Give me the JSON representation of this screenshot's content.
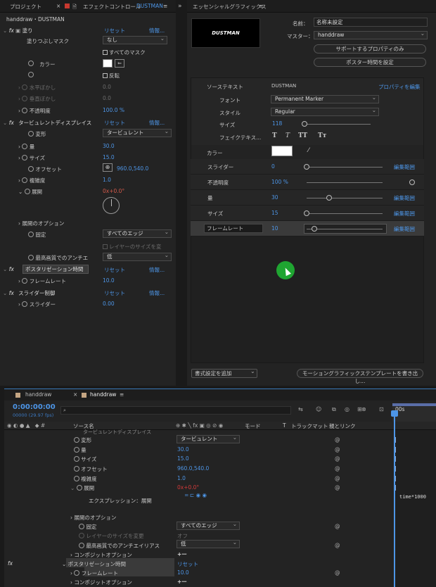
{
  "effect_controls": {
    "tab_project": "プロジェクト",
    "tab_effect_controls": "エフェクトコントロール",
    "tab_effect_target": "DUSTMAN",
    "breadcrumb": "handdraw・DUSTMAN",
    "reset": "リセット",
    "info": "情報...",
    "fill": {
      "name": "塗り",
      "mask_label": "塗りつぶしマスク",
      "mask_value": "なし",
      "all_masks": "すべてのマスク",
      "color_label": "カラー",
      "invert": "反転",
      "h_feather": "水平ぼかし",
      "h_feather_value": "0.0",
      "v_feather": "垂直ぼかし",
      "v_feather_value": "0.0",
      "opacity_label": "不透明度",
      "opacity_value": "100.0 %"
    },
    "turbulent": {
      "name": "タービュレントディスプレイス",
      "displace_label": "変形",
      "displace_value": "タービュレント",
      "amount_label": "量",
      "amount_value": "30.0",
      "size_label": "サイズ",
      "size_value": "15.0",
      "offset_label": "オフセット",
      "offset_value": "960.0,540.0",
      "complexity_label": "複雑度",
      "complexity_value": "1.0",
      "evolution_label": "展開",
      "evolution_value": "0x+0.0°",
      "evo_options": "展開のオプション",
      "pinning_label": "固定",
      "pinning_value": "すべてのエッジ",
      "resize_layer": "レイヤーのサイズを変",
      "aa_label": "最高画質でのアンチエ",
      "aa_value": "低"
    },
    "posterize": {
      "name": "ポスタリゼーション時間",
      "framerate_label": "フレームレート",
      "framerate_value": "10.0"
    },
    "slider": {
      "name": "スライダー制御",
      "slider_label": "スライダー",
      "slider_value": "0.00"
    }
  },
  "essential_graphics": {
    "title": "エッセンシャルグラフィックス",
    "preview_text": "DUSTMAN",
    "name_label": "名前：",
    "name_value": "名称未設定",
    "master_label": "マスター：",
    "master_value": "handdraw",
    "solo_supported": "サポートするプロパティのみ",
    "set_poster_time": "ポスター時間を設定",
    "source_text_label": "ソーステキスト",
    "source_text_value": "DUSTMAN",
    "edit_properties": "プロパティを編集",
    "font_label": "フォント",
    "font_value": "Permanent Marker",
    "style_label": "スタイル",
    "style_value": "Regular",
    "size_label": "サイズ",
    "size_value": "118",
    "faux_label": "フェイクテキス...",
    "faux_icons": [
      "T",
      "T",
      "TT",
      "Tт"
    ],
    "color_label": "カラー",
    "edit_range": "編集範囲",
    "rows": [
      {
        "label": "スライダー",
        "value": "0",
        "fraction": 0.0
      },
      {
        "label": "不透明度",
        "value": "100 %",
        "fraction": 1.0
      },
      {
        "label": "量",
        "value": "30",
        "fraction": 0.3
      },
      {
        "label": "サイズ",
        "value": "15",
        "fraction": 0.0
      },
      {
        "label": "フレームレート",
        "value": "10",
        "fraction": 0.1
      }
    ],
    "add_formatting": "書式設定を追加",
    "export_mogrt": "モーショングラフィックステンプレートを書き出し..."
  },
  "timeline": {
    "tab1": "handdraw",
    "tab2": "handdraw",
    "timecode": "0:00:00:00",
    "frames": "00000 (29.97 fps)",
    "col_source": "ソース名",
    "col_mode": "モード",
    "col_t": "T",
    "col_trkmat": "トラックマット",
    "col_parent": "親とリンク",
    "ruler": "00s",
    "turb_partial": "タービュレントディスプレイス",
    "rows": [
      {
        "label": "変形",
        "value": "タービュレント"
      },
      {
        "label": "量",
        "value": "30.0"
      },
      {
        "label": "サイズ",
        "value": "15.0"
      },
      {
        "label": "オフセット",
        "value": "960.0,540.0"
      },
      {
        "label": "複雑度",
        "value": "1.0"
      },
      {
        "label": "展開",
        "value": "0x+0.0°"
      }
    ],
    "expression_label": "エクスプレッション：展開",
    "expression_code": "time*1000",
    "evo_options": "展開のオプション",
    "pinning_label": "固定",
    "pinning_value": "すべてのエッジ",
    "resize_layer": "レイヤーのサイズを変更",
    "resize_value": "オフ",
    "aa_label": "最高画質でのアンチエイリアス",
    "aa_value": "低",
    "composite": "コンポジットオプション",
    "posterize": "ポスタリゼーション時間",
    "reset": "リセット",
    "framerate_label": "フレームレート",
    "framerate_value": "10.0",
    "composite2": "コンポジットオプション",
    "plus_minus": "+ー"
  },
  "colors": {
    "accent_blue": "#4d95e6",
    "cursor_green": "#1fa531",
    "keyframe_red": "#d43a3a"
  }
}
